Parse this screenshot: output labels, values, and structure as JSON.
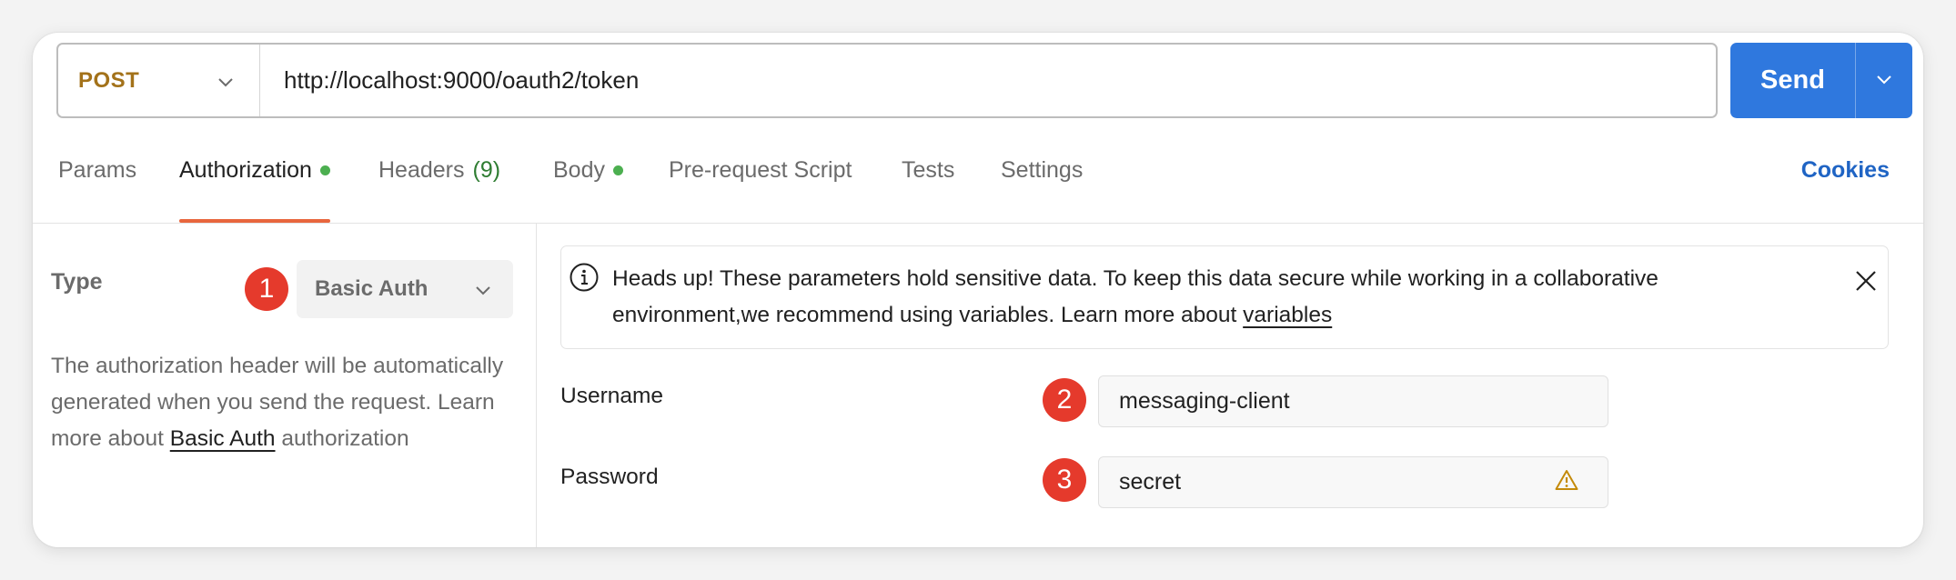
{
  "colors": {
    "accent_blue": "#2f78de",
    "method_color": "#a3721a",
    "tab_underline": "#e8663d",
    "dot_green": "#4caf50",
    "headers_count": "#2f7d32",
    "badge_red": "#e53a2c",
    "warn_amber": "#c48a0a"
  },
  "request": {
    "method": "POST",
    "url": "http://localhost:9000/oauth2/token",
    "send_label": "Send"
  },
  "tabs": [
    {
      "label": "Params"
    },
    {
      "label": "Authorization"
    },
    {
      "label": "Headers",
      "count": "(9)"
    },
    {
      "label": "Body"
    },
    {
      "label": "Pre-request Script"
    },
    {
      "label": "Tests"
    },
    {
      "label": "Settings"
    }
  ],
  "cookies_label": "Cookies",
  "auth": {
    "type_label": "Type",
    "type_value": "Basic Auth",
    "desc_before": "The authorization header will be automatically generated when you send the request. Learn more about ",
    "desc_link": "Basic Auth",
    "desc_after": " authorization"
  },
  "notice": {
    "text": "Heads up! These parameters hold sensitive data. To keep this data secure while working in a collaborative environment,we recommend using variables. Learn more about ",
    "link": "variables"
  },
  "fields": {
    "username_label": "Username",
    "username_value": "messaging-client",
    "password_label": "Password",
    "password_value": "secret"
  },
  "badges": [
    "1",
    "2",
    "3"
  ]
}
